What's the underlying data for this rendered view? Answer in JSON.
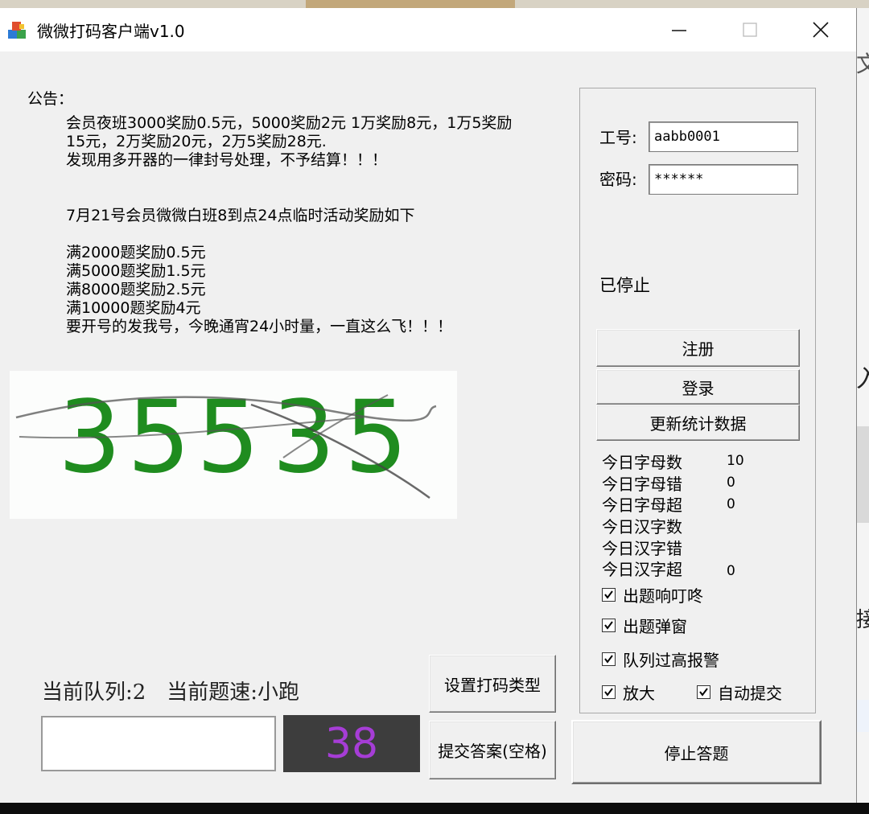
{
  "window": {
    "title": "微微打码客户端v1.0"
  },
  "notice": {
    "label": "公告：",
    "lines": [
      "会员夜班3000奖励0.5元，5000奖励2元 1万奖励8元，1万5奖励",
      "15元，2万奖励20元，2万5奖励28元.",
      "发现用多开器的一律封号处理，不予结算！！！",
      "",
      "7月21号会员微微白班8到点24点临时活动奖励如下",
      "满2000题奖励0.5元",
      "满5000题奖励1.5元",
      "满8000题奖励2.5元",
      "满10000题奖励4元",
      "要开号的发我号，今晚通宵24小时量，一直这么飞！！！"
    ]
  },
  "captcha": {
    "text": "35535",
    "digits": [
      "3",
      "5",
      "5",
      "3",
      "5"
    ],
    "color": "#1f8c1f"
  },
  "login": {
    "id_label": "工号:",
    "id_value": "aabb0001",
    "password_label": "密码:",
    "password_value": "******"
  },
  "status": "已停止",
  "buttons": {
    "register": "注册",
    "login": "登录",
    "refresh_stats": "更新统计数据",
    "set_type": "设置打码类型",
    "submit": "提交答案(空格)",
    "stop": "停止答题"
  },
  "stats": [
    {
      "label": "今日字母数",
      "value": "10"
    },
    {
      "label": "今日字母错",
      "value": "0"
    },
    {
      "label": "今日字母超",
      "value": "0"
    },
    {
      "label": "今日汉字数",
      "value": ""
    },
    {
      "label": "今日汉字错",
      "value": ""
    },
    {
      "label": "今日汉字超",
      "value": "0"
    }
  ],
  "options": {
    "sound": {
      "label": "出题响叮咚",
      "checked": true
    },
    "popup": {
      "label": "出题弹窗",
      "checked": true
    },
    "queue_alarm": {
      "label": "队列过高报警",
      "checked": true
    },
    "zoom": {
      "label": "放大",
      "checked": true
    },
    "auto_submit": {
      "label": "自动提交",
      "checked": true
    }
  },
  "queue_info": "当前队列:2　当前题速:小跑",
  "answer_value": "",
  "counter": "38",
  "colors": {
    "counter_text": "#a63dd6",
    "counter_bg": "#3d3d3d",
    "captcha_digits": "#1f8c1f"
  }
}
